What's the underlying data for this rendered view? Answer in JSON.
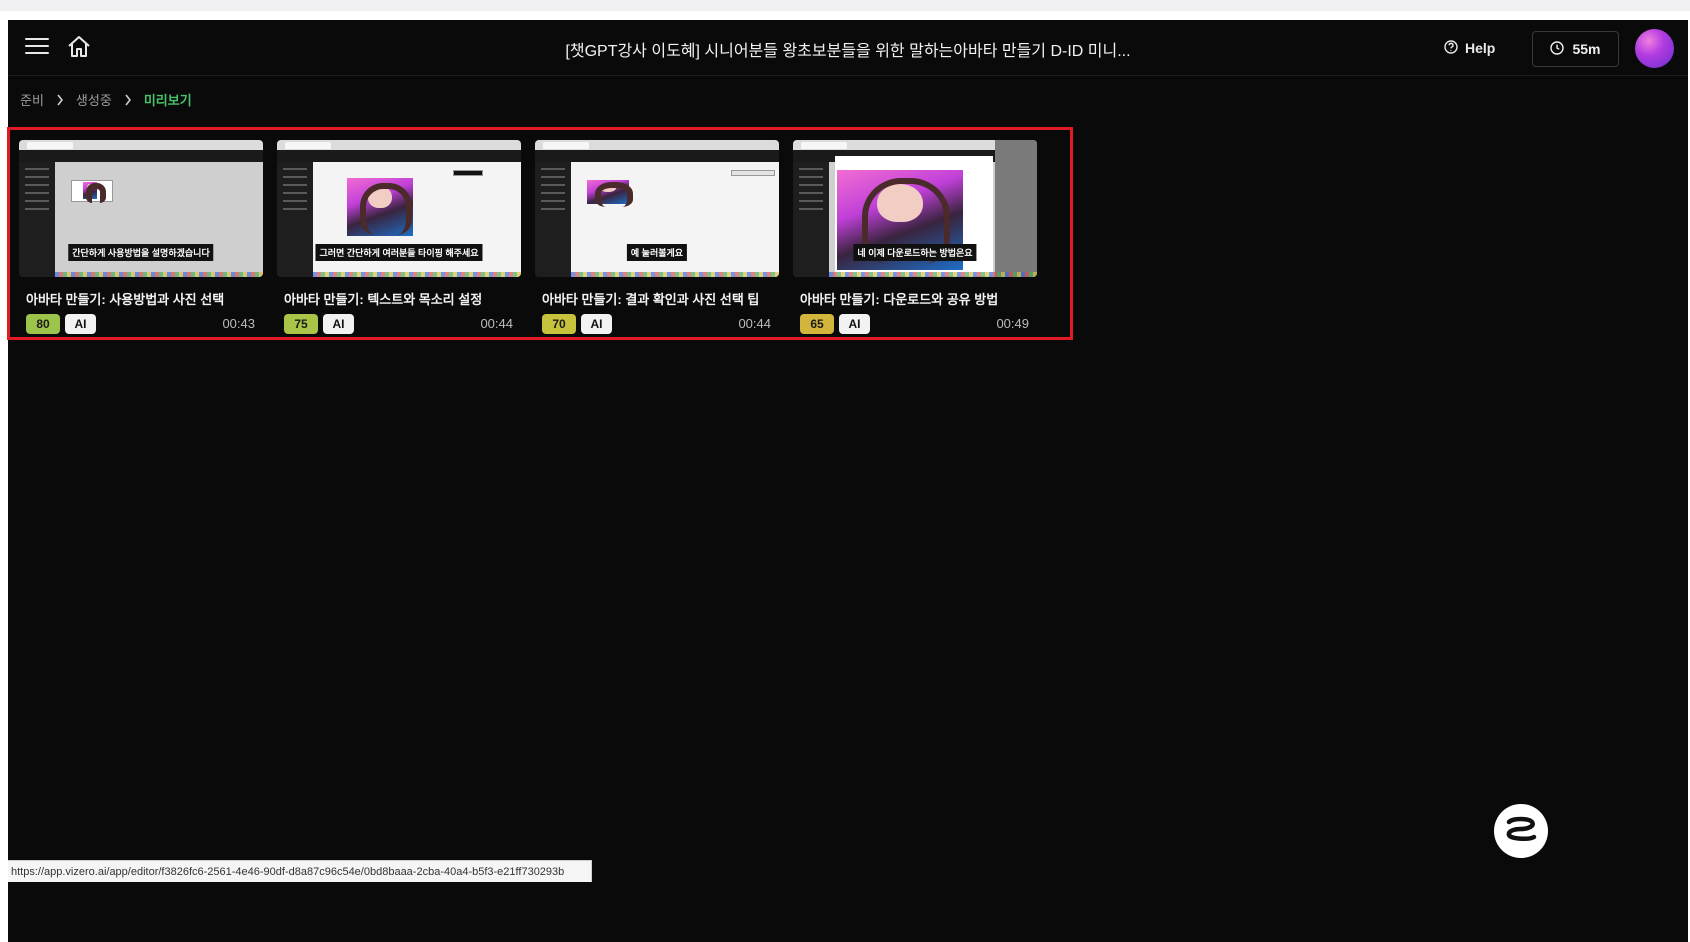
{
  "header": {
    "title": "[챗GPT강사 이도혜] 시니어분들 왕초보분들을 위한 말하는아바타 만들기 D-ID 미니...",
    "help_label": "Help",
    "credits_label": "55m",
    "icons": {
      "menu": "hamburger-icon",
      "home": "home-icon",
      "help": "help-circle-icon",
      "timer": "clock-icon"
    }
  },
  "breadcrumb": {
    "items": [
      {
        "label": "준비",
        "active": false
      },
      {
        "label": "생성중",
        "active": false
      },
      {
        "label": "미리보기",
        "active": true
      }
    ],
    "active_color": "#47c26b"
  },
  "clips": [
    {
      "title": "아바타 만들기: 사용방법과 사진 선택",
      "score": "80",
      "score_color": "#9cc44a",
      "tag": "AI",
      "duration": "00:43",
      "caption": "간단하게 사용방법을 설명하겠습니다"
    },
    {
      "title": "아바타 만들기: 텍스트와 목소리 설정",
      "score": "75",
      "score_color": "#a9c447",
      "tag": "AI",
      "duration": "00:44",
      "caption": "그러면 간단하게 여러분들 타이핑 해주세요"
    },
    {
      "title": "아바타 만들기: 결과 확인과 사진 선택 팁",
      "score": "70",
      "score_color": "#c7c23b",
      "tag": "AI",
      "duration": "00:44",
      "caption": "예 눌러볼게요"
    },
    {
      "title": "아바타 만들기: 다운로드와 공유 방법",
      "score": "65",
      "score_color": "#d2b53a",
      "tag": "AI",
      "duration": "00:49",
      "caption": "네 이제 다운로드하는 방법은요"
    }
  ],
  "highlight_color": "#e01b24",
  "status_url": "https://app.vizero.ai/app/editor/f3826fc6-2561-4e46-90df-d8a87c96c54e/0bd8baaa-2cba-40a4-b5f3-e21ff730293b"
}
